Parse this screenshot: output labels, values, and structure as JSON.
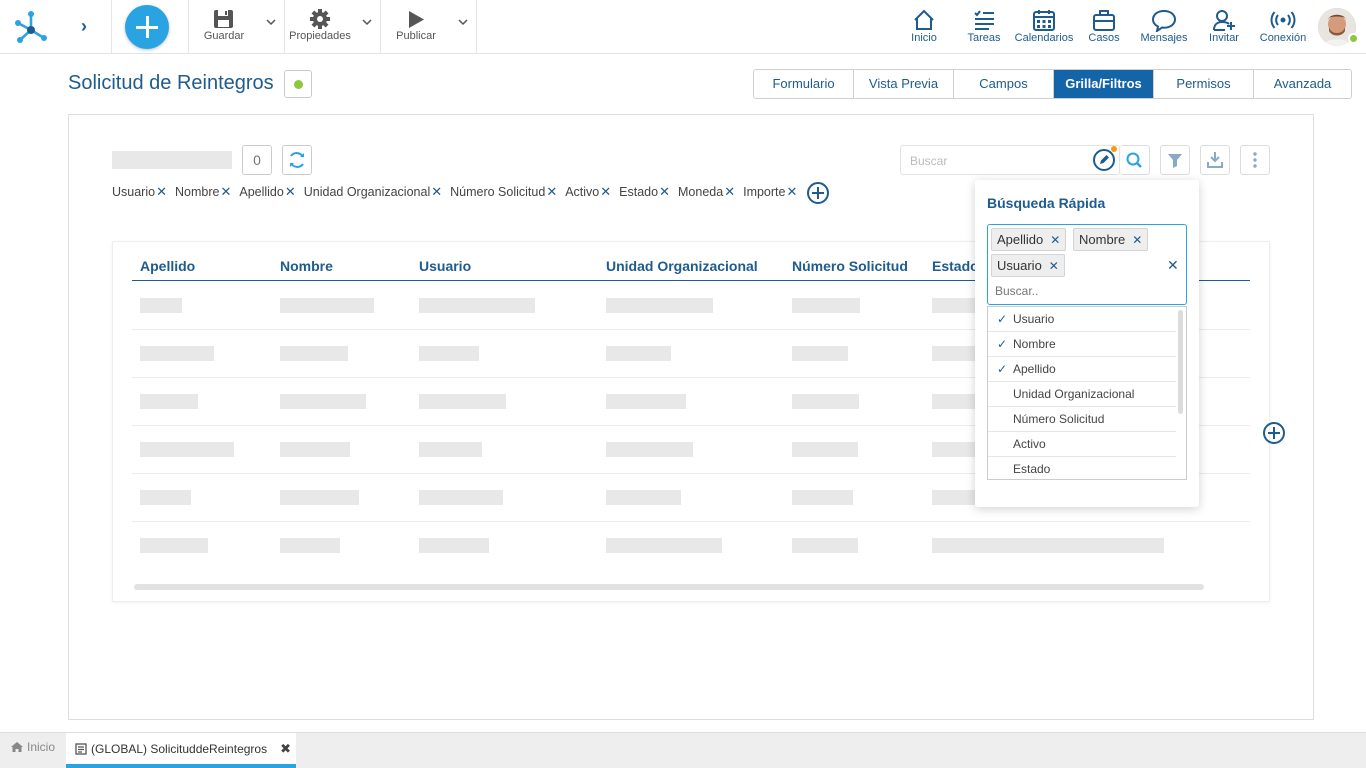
{
  "toolbar": {
    "save_label": "Guardar",
    "properties_label": "Propiedades",
    "publish_label": "Publicar"
  },
  "nav": {
    "home": "Inicio",
    "tasks": "Tareas",
    "calendars": "Calendarios",
    "cases": "Casos",
    "messages": "Mensajes",
    "invite": "Invitar",
    "connection": "Conexión"
  },
  "page": {
    "title": "Solicitud de Reintegros",
    "status_color": "#8dc63f"
  },
  "tabs": [
    {
      "label": "Formulario",
      "active": false
    },
    {
      "label": "Vista Previa",
      "active": false
    },
    {
      "label": "Campos",
      "active": false
    },
    {
      "label": "Grilla/Filtros",
      "active": true
    },
    {
      "label": "Permisos",
      "active": false
    },
    {
      "label": "Avanzada",
      "active": false
    }
  ],
  "grid_toolbar": {
    "count": "0",
    "search_placeholder": "Buscar"
  },
  "filter_chips": [
    "Usuario",
    "Nombre",
    "Apellido",
    "Unidad Organizacional",
    "Número Solicitud",
    "Activo",
    "Estado",
    "Moneda",
    "Importe"
  ],
  "grid": {
    "columns": [
      "Apellido",
      "Nombre",
      "Usuario",
      "Unidad Organizacional",
      "Número Solicitud",
      "Estado"
    ]
  },
  "quick_search": {
    "title": "Búsqueda Rápida",
    "selected": [
      "Apellido",
      "Nombre",
      "Usuario"
    ],
    "input_placeholder": "Buscar..",
    "options": [
      {
        "label": "Usuario",
        "checked": true
      },
      {
        "label": "Nombre",
        "checked": true
      },
      {
        "label": "Apellido",
        "checked": true
      },
      {
        "label": "Unidad Organizacional",
        "checked": false
      },
      {
        "label": "Número Solicitud",
        "checked": false
      },
      {
        "label": "Activo",
        "checked": false
      },
      {
        "label": "Estado",
        "checked": false
      }
    ]
  },
  "taskbar": {
    "home": "Inicio",
    "doc_tab": "(GLOBAL) SolicituddeReintegros"
  },
  "colors": {
    "primary": "#1e5b8e",
    "accent": "#2aa3e3",
    "active_tab": "#1465a8",
    "status_green": "#8dc63f",
    "notification": "#f39c12"
  }
}
